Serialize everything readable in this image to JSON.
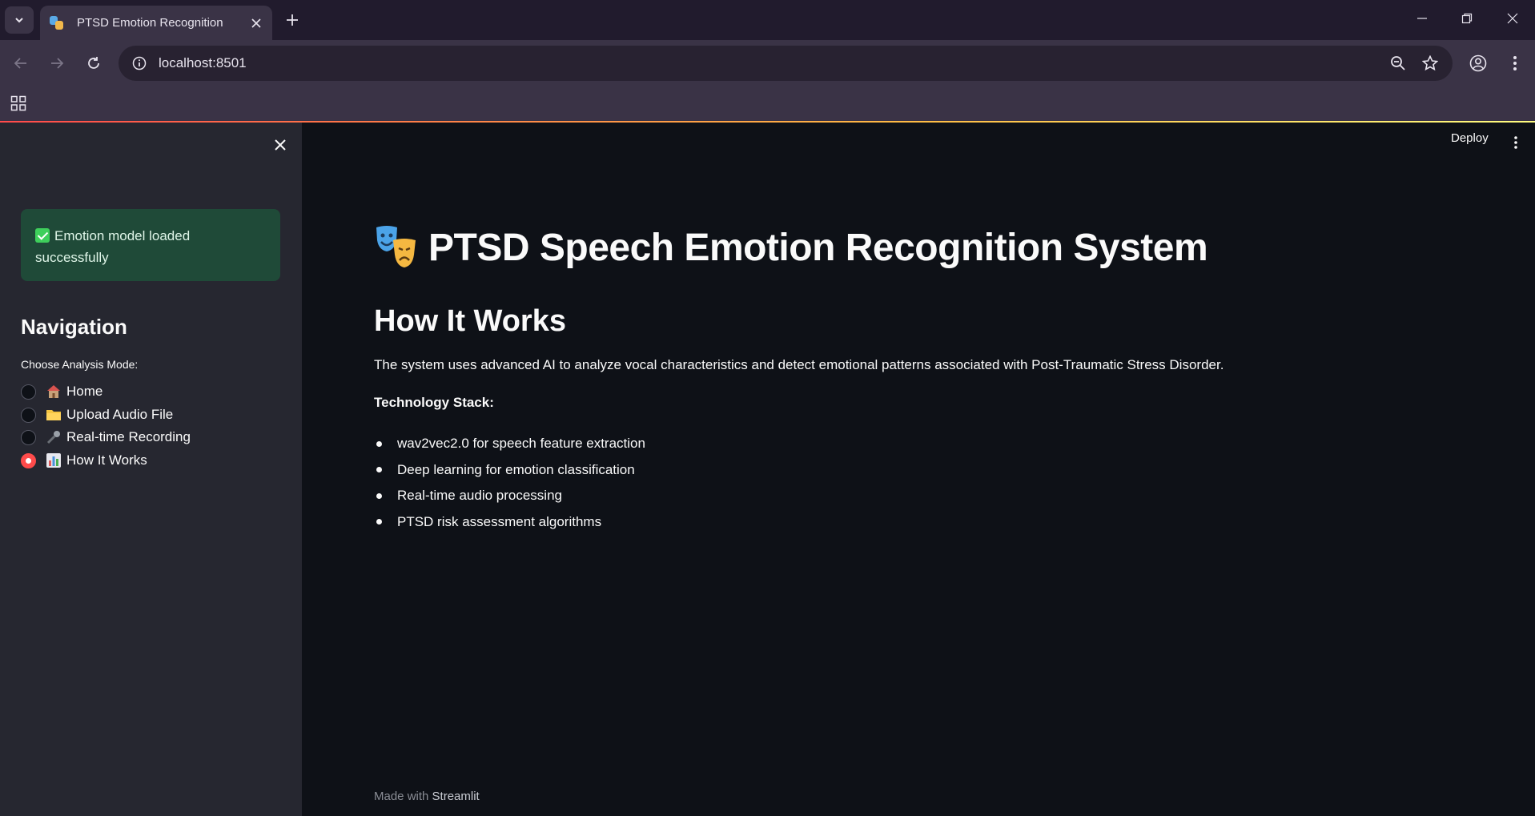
{
  "browser": {
    "tab_title": "PTSD Emotion Recognition",
    "url": "localhost:8501"
  },
  "sidebar": {
    "alert_text": "Emotion model loaded successfully",
    "heading": "Navigation",
    "radio_label": "Choose Analysis Mode:",
    "options": [
      {
        "label": "Home",
        "icon": "house-emoji",
        "selected": false
      },
      {
        "label": "Upload Audio File",
        "icon": "folder-emoji",
        "selected": false
      },
      {
        "label": "Real-time Recording",
        "icon": "microphone-emoji",
        "selected": false
      },
      {
        "label": "How It Works",
        "icon": "bar-chart-emoji",
        "selected": true
      }
    ]
  },
  "header": {
    "deploy_label": "Deploy"
  },
  "main": {
    "title": "PTSD Speech Emotion Recognition System",
    "section_heading": "How It Works",
    "description": "The system uses advanced AI to analyze vocal characteristics and detect emotional patterns associated with Post-Traumatic Stress Disorder.",
    "stack_label": "Technology Stack:",
    "stack_items": [
      "wav2vec2.0 for speech feature extraction",
      "Deep learning for emotion classification",
      "Real-time audio processing",
      "PTSD risk assessment algorithms"
    ]
  },
  "footer": {
    "made_with": "Made with",
    "link": "Streamlit"
  },
  "colors": {
    "primary": "#ff4b4b",
    "sidebar_bg": "#262730",
    "main_bg": "#0e1117",
    "alert_bg": "#1f4a38"
  }
}
